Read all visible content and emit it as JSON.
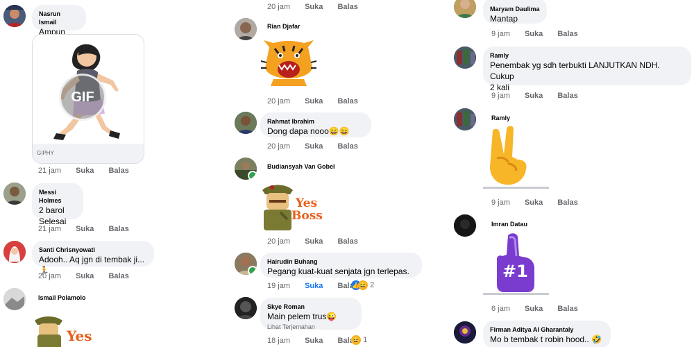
{
  "colors": {
    "bubble": "#f0f2f5",
    "meta": "#65676b",
    "like": "#1877f2",
    "online": "#31a24c"
  },
  "left": {
    "c1": {
      "name": "Nasrun Ismail",
      "text": "Ampun pak.",
      "gif_badge": "GIF",
      "gif_source": "GIPHY",
      "time": "21 jam",
      "like": "Suka",
      "reply": "Balas"
    },
    "c2": {
      "name": "Messi Holmes",
      "text": "2 barol\nSelesai",
      "time": "21 jam",
      "like": "Suka",
      "reply": "Balas"
    },
    "c3": {
      "name": "Santi Chrisnyowati",
      "text": "Adooh.. Aq jgn di tembak ji...🏃",
      "time": "20 jam",
      "like": "Suka",
      "reply": "Balas"
    },
    "c4": {
      "name": "Ismail Polamolo",
      "sticker_title": "Yes",
      "sticker_sub": "Boss"
    }
  },
  "middle": {
    "top": {
      "time": "20 jam",
      "like": "Suka",
      "reply": "Balas"
    },
    "c1": {
      "name": "Rian Djafar",
      "time": "20 jam",
      "like": "Suka",
      "reply": "Balas"
    },
    "c2": {
      "name": "Rahmat Ibrahim",
      "text": "Dong dapa nooo😄😄",
      "time": "20 jam",
      "like": "Suka",
      "reply": "Balas"
    },
    "c3": {
      "name": "Budiansyah Van Gobel",
      "sticker_title": "Yes",
      "sticker_sub": "Boss",
      "time": "20 jam",
      "like": "Suka",
      "reply": "Balas"
    },
    "c4": {
      "name": "Hairudin Buhang",
      "text": "Pegang kuat-kuat senjata jgn terlepas.",
      "time": "19 jam",
      "like": "Suka",
      "reply": "Balas",
      "reaction_count": "2"
    },
    "c5": {
      "name": "Skye Roman",
      "text": "Main pelem trus😜",
      "translate": "Lihat Terjemahan",
      "time": "18 jam",
      "like": "Suka",
      "reply": "Balas",
      "reaction_count": "1"
    }
  },
  "right": {
    "c1": {
      "name": "Maryam Daulima",
      "text": "Mantap",
      "time": "9 jam",
      "like": "Suka",
      "reply": "Balas"
    },
    "c2": {
      "name": "Ramly",
      "text": "Penembak yg sdh terbukti LANJUTKAN NDH.  Cukup\n 2 kali",
      "time": "9 jam",
      "like": "Suka",
      "reply": "Balas"
    },
    "c3": {
      "name": "Ramly",
      "time": "9 jam",
      "like": "Suka",
      "reply": "Balas"
    },
    "c4": {
      "name": "Imran Datau",
      "foam_label": "#1",
      "time": "6 jam",
      "like": "Suka",
      "reply": "Balas"
    },
    "c5": {
      "name": "Firman Aditya Al Gharantaly",
      "text": "Mo b tembak t robin hood.. 🤣"
    }
  }
}
